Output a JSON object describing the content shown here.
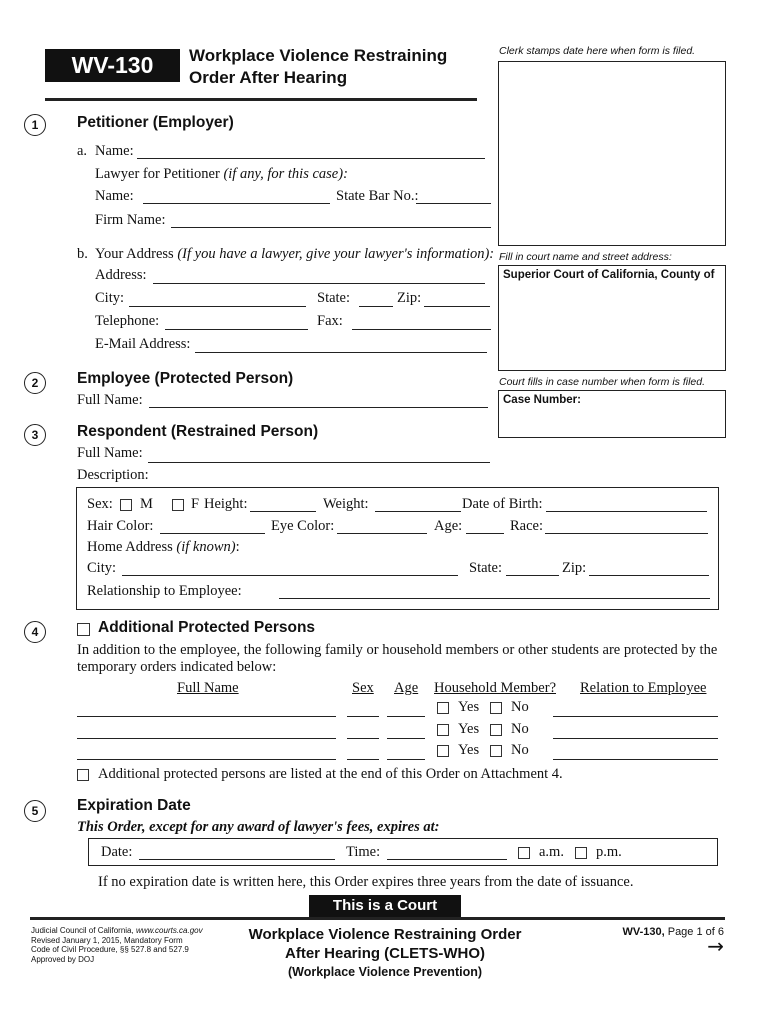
{
  "header": {
    "form_id": "WV-130",
    "title_line1": "Workplace Violence Restraining",
    "title_line2": "Order After Hearing"
  },
  "right_column": {
    "clerk_note": "Clerk stamps date here when form is filed.",
    "court_note": "Fill in court name and street address:",
    "court_label": "Superior Court of California, County of",
    "case_note": "Court fills in case number when form is filed.",
    "case_label": "Case Number:"
  },
  "section1": {
    "number": "1",
    "title": "Petitioner (Employer)",
    "a_marker": "a.",
    "name_label": "Name:",
    "lawyer_label": "Lawyer for Petitioner",
    "lawyer_hint": "(if any, for this case):",
    "lawyer_name_label": "Name:",
    "state_bar_label": "State Bar No.:",
    "firm_label": "Firm Name:",
    "b_marker": "b.",
    "address_heading": "Your Address",
    "address_hint": "(If you have a lawyer, give your lawyer's information):",
    "address_label": "Address:",
    "city_label": "City:",
    "state_label": "State:",
    "zip_label": "Zip:",
    "telephone_label": "Telephone:",
    "fax_label": "Fax:",
    "email_label": "E-Mail Address:"
  },
  "section2": {
    "number": "2",
    "title": "Employee (Protected Person)",
    "full_name_label": "Full Name:"
  },
  "section3": {
    "number": "3",
    "title": "Respondent (Restrained Person)",
    "full_name_label": "Full Name:",
    "description_label": "Description:",
    "sex_label": "Sex:",
    "male": "M",
    "female": "F",
    "height_label": "Height:",
    "weight_label": "Weight:",
    "dob_label": "Date of Birth:",
    "hair_label": "Hair Color:",
    "eye_label": "Eye Color:",
    "age_label": "Age:",
    "race_label": "Race:",
    "home_address_label": "Home Address",
    "home_address_hint": "(if known)",
    "home_address_colon": ":",
    "city_label": "City:",
    "state_label": "State:",
    "zip_label": "Zip:",
    "relationship_label": "Relationship to Employee:"
  },
  "section4": {
    "number": "4",
    "title": "Additional Protected Persons",
    "intro_line1": "In addition to the employee, the following family or household members or other students are protected by the",
    "intro_line2": "temporary orders indicated below:",
    "columns": [
      "Full Name",
      "Sex",
      "Age",
      "Household Member?",
      "Relation to Employee"
    ],
    "rows": [
      {
        "yes": "Yes",
        "no": "No"
      },
      {
        "yes": "Yes",
        "no": "No"
      },
      {
        "yes": "Yes",
        "no": "No"
      }
    ],
    "attachment_note": "Additional protected persons are listed at the end of this Order on Attachment 4."
  },
  "section5": {
    "number": "5",
    "title": "Expiration Date",
    "subtitle": "This Order, except for any award of lawyer's fees, expires at:",
    "date_label": "Date:",
    "time_label": "Time:",
    "am": "a.m.",
    "pm": "p.m.",
    "default_note": "If no expiration date is written here, this Order expires three years from the date of issuance."
  },
  "banner": "This is a Court Order.",
  "footer": {
    "left_line1_prefix": "Judicial Council of California, ",
    "left_line1_url": "www.courts.ca.gov",
    "left_line2": "Revised January 1, 2015, Mandatory Form",
    "left_line3": "Code of Civil Procedure, §§ 527.8 and 527.9",
    "left_line4": "Approved by DOJ",
    "center_line1": "Workplace Violence Restraining Order",
    "center_line2": "After Hearing (CLETS-WHO)",
    "center_line3": "(Workplace Violence Prevention)",
    "form_id": "WV-130,",
    "page": " Page 1 of 6",
    "next_icon": "→"
  }
}
